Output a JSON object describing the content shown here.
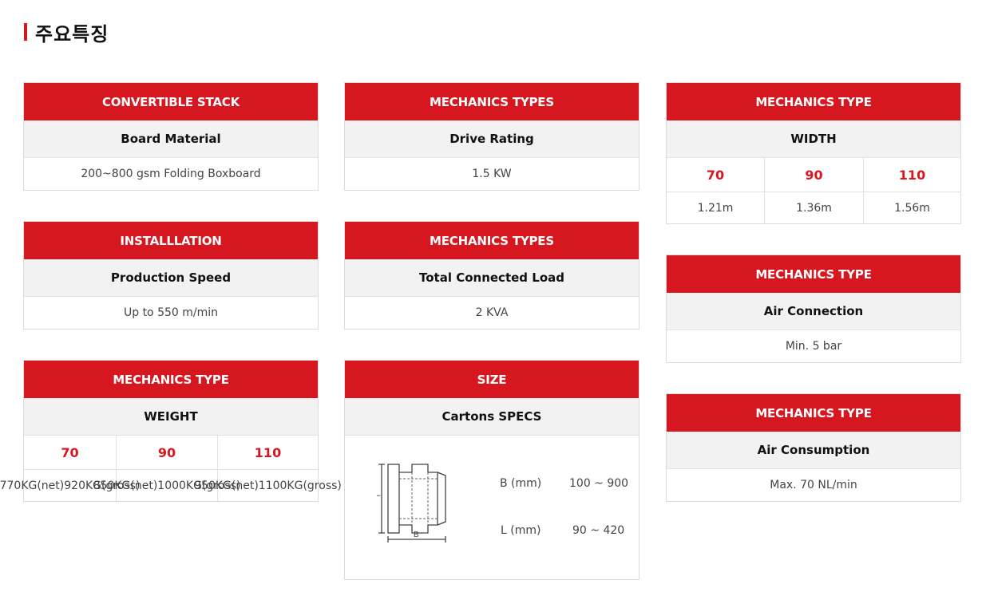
{
  "page": {
    "title": "주요특징"
  },
  "cards": {
    "convertible": {
      "header": "CONVERTIBLE STACK",
      "sub": "Board Material",
      "value": "200~800 gsm Folding Boxboard"
    },
    "installation": {
      "header": "INSTALLLATION",
      "sub": "Production Speed",
      "value": "Up to 550 m/min"
    },
    "weight": {
      "header": "MECHANICS TYPE",
      "sub": "WEIGHT",
      "cols": [
        "70",
        "90",
        "110"
      ],
      "net": [
        "770KG(net)",
        "850KG(net)",
        "950KG(net)"
      ],
      "gross": [
        "920KG(gross)",
        "1000KG(gross)",
        "1100KG(gross)"
      ]
    },
    "drive": {
      "header": "MECHANICS TYPES",
      "sub": "Drive Rating",
      "value": "1.5 KW"
    },
    "load": {
      "header": "MECHANICS TYPES",
      "sub": "Total Connected Load",
      "value": "2 KVA"
    },
    "size": {
      "header": "SIZE",
      "sub": "Cartons SPECS",
      "diagram": {
        "label_l": "L",
        "label_b": "B"
      },
      "specs": [
        {
          "label": "B (mm)",
          "value": "100 ~ 900"
        },
        {
          "label": "L (mm)",
          "value": "90 ~ 420"
        }
      ]
    },
    "width": {
      "header": "MECHANICS TYPE",
      "sub": "WIDTH",
      "cols": [
        "70",
        "90",
        "110"
      ],
      "values": [
        "1.21m",
        "1.36m",
        "1.56m"
      ]
    },
    "air_connection": {
      "header": "MECHANICS TYPE",
      "sub": "Air Connection",
      "value": "Min. 5 bar"
    },
    "air_consumption": {
      "header": "MECHANICS TYPE",
      "sub": "Air Consumption",
      "value": "Max. 70 NL/min"
    }
  },
  "colors": {
    "accent": "#d7171f",
    "sub_bg": "#f2f2f2",
    "border": "#dcdcdc"
  }
}
